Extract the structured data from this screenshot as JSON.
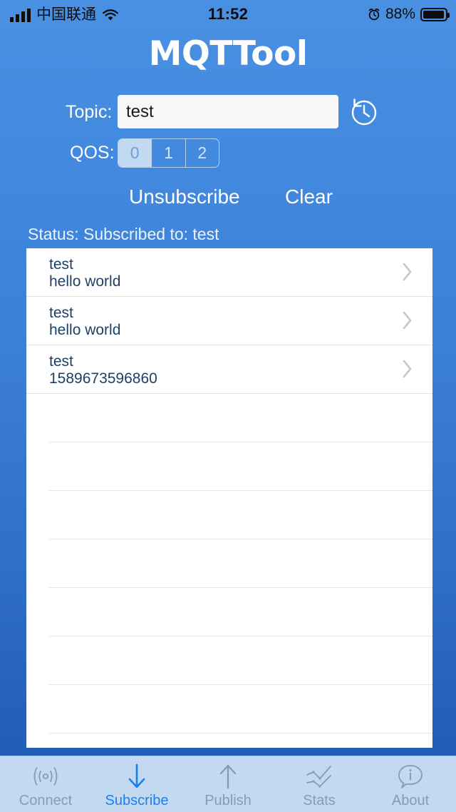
{
  "status_bar": {
    "carrier": "中国联通",
    "time": "11:52",
    "battery_percent": "88%",
    "signal_icon": "signal-bars-icon",
    "wifi_icon": "wifi-icon",
    "alarm_icon": "alarm-clock-icon",
    "battery_icon": "battery-icon"
  },
  "header": {
    "title": "MQTTool"
  },
  "topic": {
    "label": "Topic:",
    "value": "test",
    "placeholder": "",
    "history_icon": "history-clock-icon"
  },
  "qos": {
    "label": "QOS:",
    "options": [
      "0",
      "1",
      "2"
    ],
    "selected": "0"
  },
  "actions": {
    "unsubscribe_label": "Unsubscribe",
    "clear_label": "Clear"
  },
  "status": {
    "text": "Status: Subscribed to: test"
  },
  "messages": [
    {
      "topic": "test",
      "body": "hello world",
      "chevron_icon": "chevron-right-icon"
    },
    {
      "topic": "test",
      "body": "hello world",
      "chevron_icon": "chevron-right-icon"
    },
    {
      "topic": "test",
      "body": "1589673596860",
      "chevron_icon": "chevron-right-icon"
    }
  ],
  "empty_rows": 8,
  "tabs": [
    {
      "label": "Connect",
      "icon": "broadcast-icon",
      "active": false
    },
    {
      "label": "Subscribe",
      "icon": "arrow-down-icon",
      "active": true
    },
    {
      "label": "Publish",
      "icon": "arrow-up-icon",
      "active": false
    },
    {
      "label": "Stats",
      "icon": "line-chart-icon",
      "active": false
    },
    {
      "label": "About",
      "icon": "info-bubble-icon",
      "active": false
    }
  ],
  "colors": {
    "background_top": "#4a90e2",
    "background_bottom": "#1e59b3",
    "panel": "#ffffff",
    "accent": "#1a7ff0",
    "tabbar": "#c3d9f0",
    "text_on_blue": "#ffffff",
    "list_text": "#1f3f66",
    "chevron": "#c7c7cc",
    "segment_selected": "#c3d9f2"
  }
}
